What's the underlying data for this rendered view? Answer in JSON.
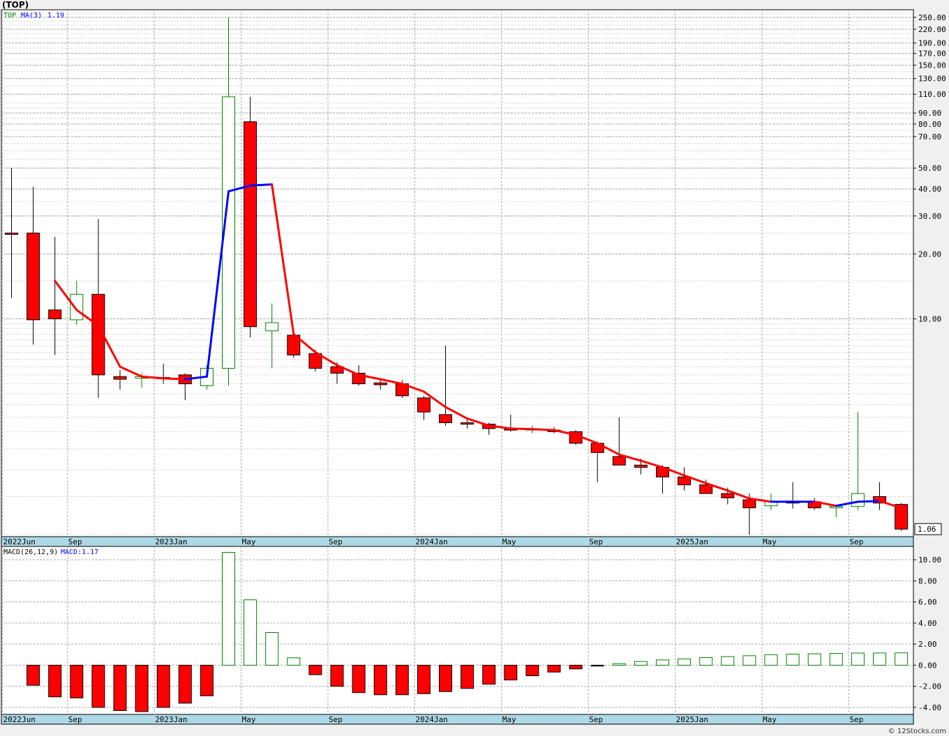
{
  "header": {
    "title": "(TOP)"
  },
  "watermark": "© 12Stocks.com",
  "colors": {
    "up": "#008000",
    "down": "#ff0000",
    "ma_down": "#ff0000",
    "ma_up": "#0000ff",
    "grid": "#a9a9a9",
    "date_band": "#add8e6",
    "last_price_box": "#ffffff"
  },
  "chart_data": [
    {
      "type": "candlestick",
      "interval": "monthly",
      "y_scale": "log",
      "legend": {
        "symbol": "TOP",
        "ma_label": "MA(3)",
        "ma_value": "1.19"
      },
      "last_price_label": "1.06",
      "ylim": [
        1.0,
        265
      ],
      "y_ticks": [
        "250.00",
        "220.00",
        "190.00",
        "170.00",
        "150.00",
        "130.00",
        "110.00",
        "90.00",
        "80.00",
        "70.00",
        "50.00",
        "40.00",
        "30.00",
        "20.00",
        "10.00"
      ],
      "x_labels": [
        "2022Jun",
        "Sep",
        "2023Jan",
        "May",
        "Sep",
        "2024Jan",
        "May",
        "Sep",
        "2025Jan",
        "May",
        "Sep"
      ],
      "dates": [
        "2022-06",
        "2022-07",
        "2022-08",
        "2022-09",
        "2022-10",
        "2022-11",
        "2022-12",
        "2023-01",
        "2023-02",
        "2023-03",
        "2023-04",
        "2023-05",
        "2023-06",
        "2023-07",
        "2023-08",
        "2023-09",
        "2023-10",
        "2023-11",
        "2023-12",
        "2023-01b",
        "2024-02",
        "2024-03",
        "2024-04",
        "2024-05",
        "2024-06",
        "2024-07",
        "2024-08",
        "2024-09",
        "2024-10",
        "2024-11",
        "2024-12",
        "2025-01",
        "2025-02",
        "2025-03",
        "2025-04",
        "2025-05",
        "2025-06",
        "2025-07",
        "2025-08",
        "2025-09",
        "2025-10",
        "2025-11"
      ],
      "candles": [
        {
          "o": 25.0,
          "h": 50.0,
          "l": 12.5,
          "c": 25.0
        },
        {
          "o": 25.0,
          "h": 41.0,
          "l": 7.6,
          "c": 9.9
        },
        {
          "o": 11.0,
          "h": 24.0,
          "l": 6.8,
          "c": 10.0
        },
        {
          "o": 9.9,
          "h": 15.0,
          "l": 9.4,
          "c": 13.0
        },
        {
          "o": 13.0,
          "h": 29.0,
          "l": 4.3,
          "c": 5.5
        },
        {
          "o": 5.4,
          "h": 5.8,
          "l": 4.7,
          "c": 5.25
        },
        {
          "o": 5.3,
          "h": 5.6,
          "l": 4.8,
          "c": 5.4
        },
        {
          "o": 5.35,
          "h": 6.2,
          "l": 5.0,
          "c": 5.3
        },
        {
          "o": 5.5,
          "h": 5.6,
          "l": 4.2,
          "c": 5.0
        },
        {
          "o": 4.9,
          "h": 6.1,
          "l": 4.7,
          "c": 5.9
        },
        {
          "o": 5.9,
          "h": 250.0,
          "l": 4.9,
          "c": 107.0
        },
        {
          "o": 82.0,
          "h": 107.0,
          "l": 8.2,
          "c": 9.2
        },
        {
          "o": 8.8,
          "h": 11.8,
          "l": 5.9,
          "c": 9.6
        },
        {
          "o": 8.4,
          "h": 8.5,
          "l": 6.6,
          "c": 6.8
        },
        {
          "o": 6.9,
          "h": 7.2,
          "l": 5.7,
          "c": 5.9
        },
        {
          "o": 6.0,
          "h": 6.3,
          "l": 5.0,
          "c": 5.6
        },
        {
          "o": 5.6,
          "h": 6.1,
          "l": 4.9,
          "c": 5.0
        },
        {
          "o": 5.05,
          "h": 5.3,
          "l": 4.7,
          "c": 4.95
        },
        {
          "o": 5.0,
          "h": 5.2,
          "l": 4.3,
          "c": 4.4
        },
        {
          "o": 4.3,
          "h": 4.4,
          "l": 3.4,
          "c": 3.7
        },
        {
          "o": 3.6,
          "h": 7.5,
          "l": 3.2,
          "c": 3.3
        },
        {
          "o": 3.3,
          "h": 3.4,
          "l": 3.1,
          "c": 3.25
        },
        {
          "o": 3.25,
          "h": 3.3,
          "l": 2.9,
          "c": 3.1
        },
        {
          "o": 3.1,
          "h": 3.6,
          "l": 3.0,
          "c": 3.05
        },
        {
          "o": 3.05,
          "h": 3.2,
          "l": 2.95,
          "c": 3.1
        },
        {
          "o": 3.05,
          "h": 3.15,
          "l": 2.95,
          "c": 3.0
        },
        {
          "o": 3.0,
          "h": 3.05,
          "l": 2.6,
          "c": 2.65
        },
        {
          "o": 2.65,
          "h": 2.7,
          "l": 1.75,
          "c": 2.4
        },
        {
          "o": 2.3,
          "h": 3.5,
          "l": 2.1,
          "c": 2.1
        },
        {
          "o": 2.1,
          "h": 2.25,
          "l": 1.9,
          "c": 2.05
        },
        {
          "o": 2.05,
          "h": 2.1,
          "l": 1.55,
          "c": 1.85
        },
        {
          "o": 1.85,
          "h": 2.05,
          "l": 1.6,
          "c": 1.7
        },
        {
          "o": 1.7,
          "h": 1.8,
          "l": 1.55,
          "c": 1.55
        },
        {
          "o": 1.55,
          "h": 1.65,
          "l": 1.38,
          "c": 1.48
        },
        {
          "o": 1.45,
          "h": 1.55,
          "l": 1.0,
          "c": 1.33
        },
        {
          "o": 1.36,
          "h": 1.55,
          "l": 1.3,
          "c": 1.42
        },
        {
          "o": 1.43,
          "h": 1.75,
          "l": 1.32,
          "c": 1.4
        },
        {
          "o": 1.42,
          "h": 1.48,
          "l": 1.3,
          "c": 1.33
        },
        {
          "o": 1.33,
          "h": 1.36,
          "l": 1.2,
          "c": 1.35
        },
        {
          "o": 1.35,
          "h": 3.7,
          "l": 1.3,
          "c": 1.55
        },
        {
          "o": 1.5,
          "h": 1.75,
          "l": 1.3,
          "c": 1.4
        },
        {
          "o": 1.38,
          "h": 1.4,
          "l": 1.04,
          "c": 1.06
        }
      ],
      "ma3": [
        null,
        null,
        15.0,
        11.0,
        9.3,
        6.0,
        5.4,
        5.3,
        5.25,
        5.4,
        39.0,
        41.5,
        42.0,
        8.5,
        7.0,
        6.1,
        5.5,
        5.25,
        5.0,
        4.6,
        3.9,
        3.45,
        3.2,
        3.1,
        3.08,
        3.05,
        2.9,
        2.65,
        2.35,
        2.2,
        2.05,
        1.88,
        1.73,
        1.6,
        1.47,
        1.42,
        1.42,
        1.42,
        1.36,
        1.42,
        1.43,
        1.33
      ]
    },
    {
      "type": "bar",
      "name": "MACD(26,12,9)",
      "legend": {
        "label": "MACD(26,12,9)",
        "value_label": "MACD:1.17"
      },
      "ylim": [
        -4.4,
        11.0
      ],
      "y_ticks": [
        "10.00",
        "8.00",
        "6.00",
        "4.00",
        "2.00",
        "0.00",
        "-2.00",
        "-4.00"
      ],
      "x_labels": [
        "2022Jun",
        "Sep",
        "2023Jan",
        "May",
        "Sep",
        "2024Jan",
        "May",
        "Sep",
        "2025Jan",
        "May",
        "Sep"
      ],
      "values": [
        null,
        -1.9,
        -3.0,
        -3.1,
        -4.0,
        -4.3,
        -4.4,
        -4.0,
        -3.6,
        -2.9,
        10.7,
        6.2,
        3.1,
        0.7,
        -0.9,
        -2.0,
        -2.6,
        -2.8,
        -2.8,
        -2.7,
        -2.5,
        -2.2,
        -1.8,
        -1.4,
        -1.0,
        -0.65,
        -0.35,
        -0.08,
        0.15,
        0.35,
        0.5,
        0.6,
        0.72,
        0.82,
        0.9,
        1.0,
        1.05,
        1.08,
        1.12,
        1.15,
        1.16,
        1.17
      ]
    }
  ]
}
